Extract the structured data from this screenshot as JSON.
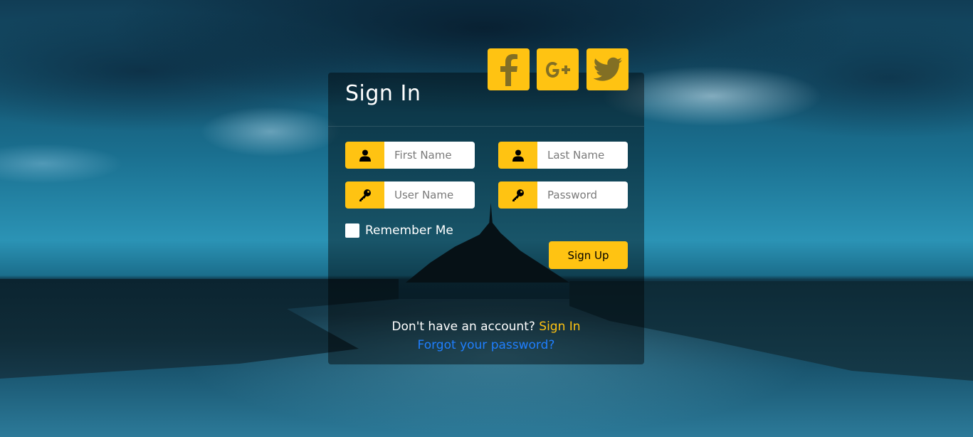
{
  "title": "Sign In",
  "social": [
    {
      "name": "facebook-icon"
    },
    {
      "name": "google-plus-icon"
    },
    {
      "name": "twitter-icon"
    }
  ],
  "fields": {
    "first_name": {
      "placeholder": "First Name",
      "icon": "user-icon"
    },
    "last_name": {
      "placeholder": "Last Name",
      "icon": "user-icon"
    },
    "user_name": {
      "placeholder": "User Name",
      "icon": "key-icon"
    },
    "password": {
      "placeholder": "Password",
      "icon": "key-icon"
    }
  },
  "remember_label": "Remember Me",
  "signup_label": "Sign Up",
  "footer": {
    "question": "Don't have an account?",
    "signin_link": "Sign In",
    "forgot_link": "Forgot your password?"
  },
  "colors": {
    "accent": "#ffc312",
    "link": "#1f7fff"
  }
}
